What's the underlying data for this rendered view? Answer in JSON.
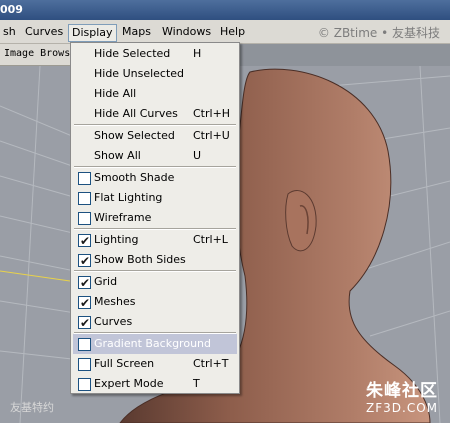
{
  "window": {
    "title_fragment": "009"
  },
  "menubar": {
    "items": [
      {
        "label": "sh"
      },
      {
        "label": "Curves"
      },
      {
        "label": "Display"
      },
      {
        "label": "Maps"
      },
      {
        "label": "Windows"
      },
      {
        "label": "Help"
      }
    ],
    "watermark": "© ZBtime • 友基科技"
  },
  "toolstrip": {
    "label": "Image Brows"
  },
  "display_menu": {
    "items": [
      {
        "label": "Hide Selected",
        "accel": "H"
      },
      {
        "label": "Hide Unselected",
        "accel": ""
      },
      {
        "label": "Hide All",
        "accel": ""
      },
      {
        "label": "Hide All Curves",
        "accel": "Ctrl+H"
      },
      {
        "label": "Show Selected",
        "accel": "Ctrl+U"
      },
      {
        "label": "Show All",
        "accel": "U"
      },
      {
        "label": "Smooth Shade",
        "accel": "",
        "checked": false
      },
      {
        "label": "Flat Lighting",
        "accel": "",
        "checked": false
      },
      {
        "label": "Wireframe",
        "accel": "",
        "checked": false
      },
      {
        "label": "Lighting",
        "accel": "Ctrl+L",
        "checked": true
      },
      {
        "label": "Show Both Sides",
        "accel": "",
        "checked": true
      },
      {
        "label": "Grid",
        "accel": "",
        "checked": true
      },
      {
        "label": "Meshes",
        "accel": "",
        "checked": true
      },
      {
        "label": "Curves",
        "accel": "",
        "checked": true
      },
      {
        "label": "Gradient Background",
        "accel": "",
        "checked": false,
        "highlighted": true
      },
      {
        "label": "Full Screen",
        "accel": "Ctrl+T",
        "checked": false
      },
      {
        "label": "Expert Mode",
        "accel": "T",
        "checked": false
      }
    ]
  },
  "viewport": {
    "watermark_left": "友基特约",
    "watermark_right_cn": "朱峰社区",
    "watermark_right_en": "ZF3D.COM"
  },
  "colors": {
    "accent": "#316ac5",
    "highlight": "#c1c5d8",
    "head": "#8a5a48"
  }
}
